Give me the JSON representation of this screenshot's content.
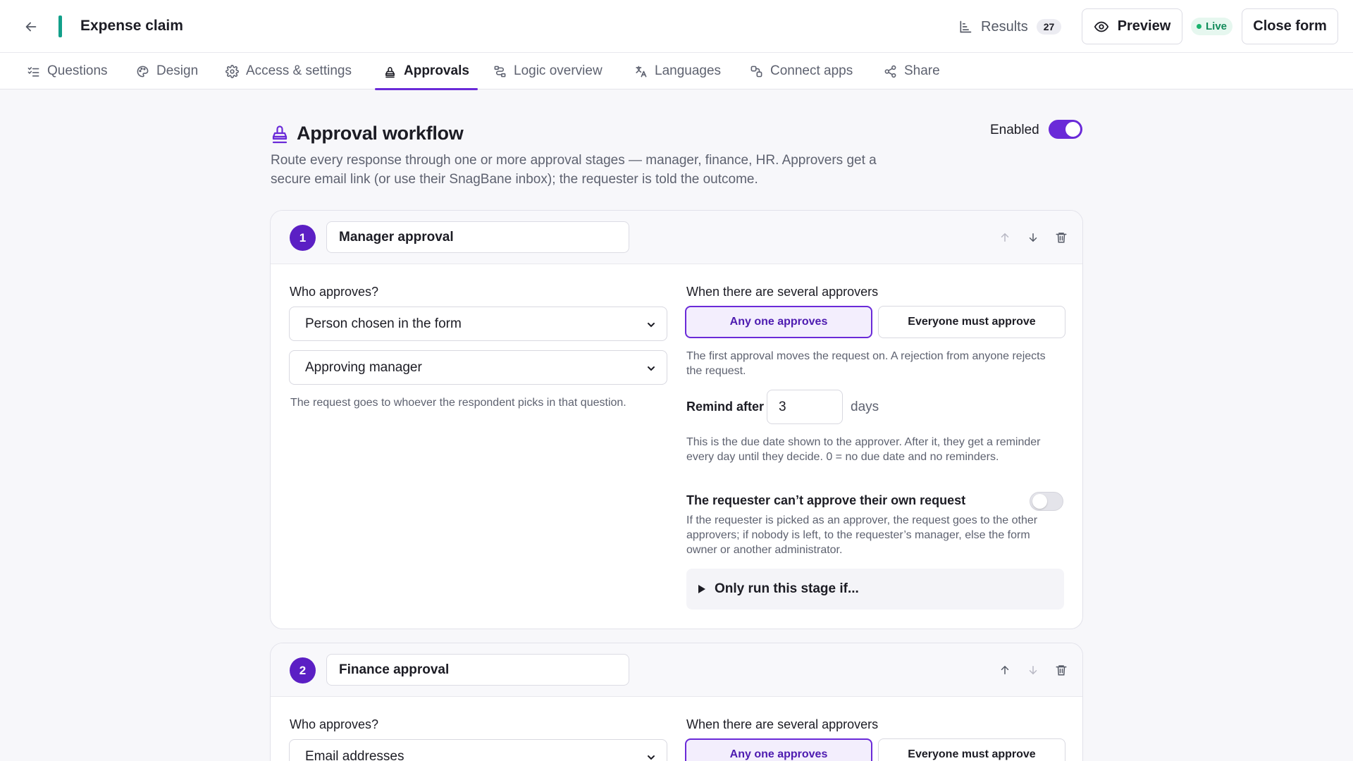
{
  "header": {
    "form_title": "Expense claim",
    "results_label": "Results",
    "results_count": "27",
    "preview_label": "Preview",
    "live_label": "Live",
    "close_label": "Close form"
  },
  "tabs": [
    {
      "label": "Questions",
      "icon": "checklist-icon"
    },
    {
      "label": "Design",
      "icon": "palette-icon"
    },
    {
      "label": "Access & settings",
      "icon": "gear-icon"
    },
    {
      "label": "Approvals",
      "icon": "stamp-icon",
      "active": true
    },
    {
      "label": "Logic overview",
      "icon": "flow-icon"
    },
    {
      "label": "Languages",
      "icon": "translate-icon"
    },
    {
      "label": "Connect apps",
      "icon": "connect-icon"
    },
    {
      "label": "Share",
      "icon": "share-icon"
    }
  ],
  "workflow": {
    "title": "Approval workflow",
    "description": "Route every response through one or more approval stages — manager, finance, HR. Approvers get a secure email link (or use their SnagBane inbox); the requester is told the outcome.",
    "enabled_label": "Enabled",
    "enabled": true
  },
  "stages": [
    {
      "number": "1",
      "name": "Manager approval",
      "who_label": "Who approves?",
      "approver_type": "Person chosen in the form",
      "approver_question": "Approving manager",
      "who_help": "The request goes to whoever the respondent picks in that question.",
      "several_label": "When there are several approvers",
      "option_any": "Any one approves",
      "option_all": "Everyone must approve",
      "mode_help": "The first approval moves the request on. A rejection from anyone rejects the request.",
      "remind_label": "Remind after",
      "remind_value": "3",
      "remind_unit": "days",
      "remind_help": "This is the due date shown to the approver. After it, they get a reminder every day until they decide. 0 = no due date and no reminders.",
      "self_title": "The requester can’t approve their own request",
      "self_enabled": false,
      "self_help": "If the requester is picked as an approver, the request goes to the other approvers; if nobody is left, to the requester’s manager, else the form owner or another administrator.",
      "condition_label": "Only run this stage if..."
    },
    {
      "number": "2",
      "name": "Finance approval",
      "who_label": "Who approves?",
      "approver_type": "Email addresses",
      "several_label": "When there are several approvers",
      "option_any": "Any one approves",
      "option_all": "Everyone must approve"
    }
  ],
  "colors": {
    "accent": "#6a2ad8",
    "brand_bar": "#12a08a",
    "live": "#19b36e"
  }
}
